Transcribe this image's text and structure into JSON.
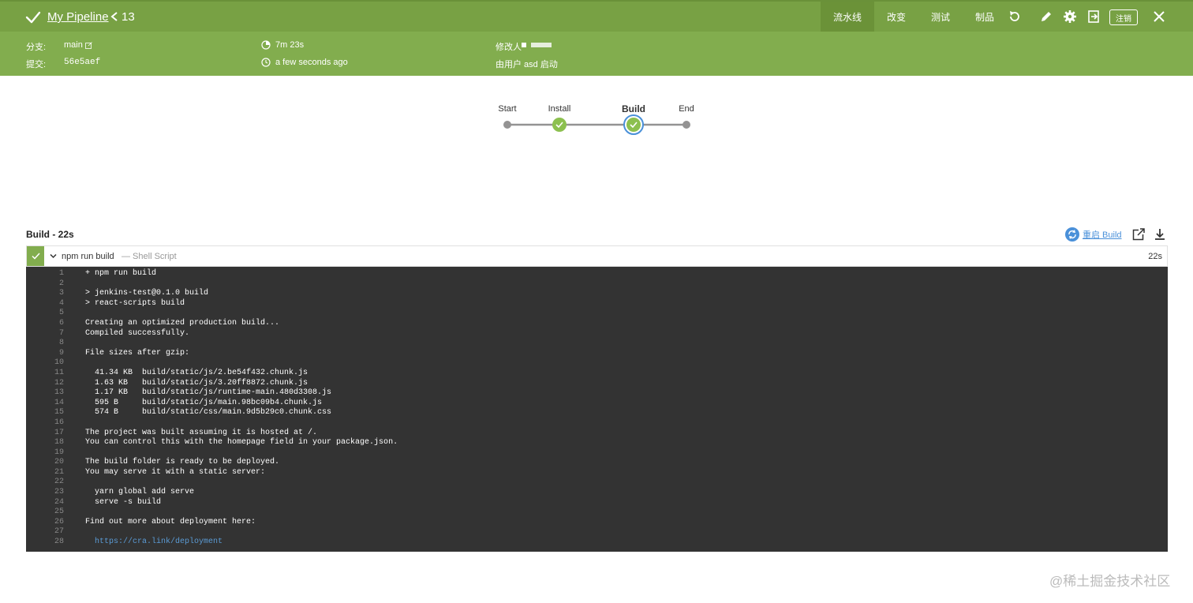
{
  "header": {
    "pipeline_name": "My Pipeline",
    "run_number": "13",
    "nav_tabs": [
      {
        "label": "流水线",
        "active": true
      },
      {
        "label": "改变",
        "active": false
      },
      {
        "label": "测试",
        "active": false
      },
      {
        "label": "制品",
        "active": false
      }
    ],
    "logout_label": "注销",
    "branch_label": "分支:",
    "branch_value": "main",
    "commit_label": "提交:",
    "commit_value": "56e5aef",
    "duration": "7m 23s",
    "time_ago": "a few seconds ago",
    "changes_by": "修改人",
    "started_by": "由用户 asd 启动",
    "colors": {
      "header": "#82ad4e",
      "topbar": "#78a144",
      "active_tab": "#6b9238"
    }
  },
  "pipeline": {
    "stages": [
      {
        "label": "Start",
        "status": "none"
      },
      {
        "label": "Install",
        "status": "success"
      },
      {
        "label": "Build",
        "status": "success",
        "selected": true
      },
      {
        "label": "End",
        "status": "none"
      }
    ]
  },
  "build": {
    "title": "Build - 22s",
    "restart_label": "重启 Build",
    "step": {
      "name": "npm run build",
      "type": "— Shell Script",
      "duration": "22s"
    },
    "log_lines": [
      "+ npm run build",
      "",
      "> jenkins-test@0.1.0 build",
      "> react-scripts build",
      "",
      "Creating an optimized production build...",
      "Compiled successfully.",
      "",
      "File sizes after gzip:",
      "",
      "  41.34 KB  build/static/js/2.be54f432.chunk.js",
      "  1.63 KB   build/static/js/3.20ff8872.chunk.js",
      "  1.17 KB   build/static/js/runtime-main.480d3308.js",
      "  595 B     build/static/js/main.98bc09b4.chunk.js",
      "  574 B     build/static/css/main.9d5b29c0.chunk.css",
      "",
      "The project was built assuming it is hosted at /.",
      "You can control this with the homepage field in your package.json.",
      "",
      "The build folder is ready to be deployed.",
      "You may serve it with a static server:",
      "",
      "  yarn global add serve",
      "  serve -s build",
      "",
      "Find out more about deployment here:",
      "",
      "  https://cra.link/deployment"
    ]
  },
  "watermark": "@稀土掘金技术社区"
}
